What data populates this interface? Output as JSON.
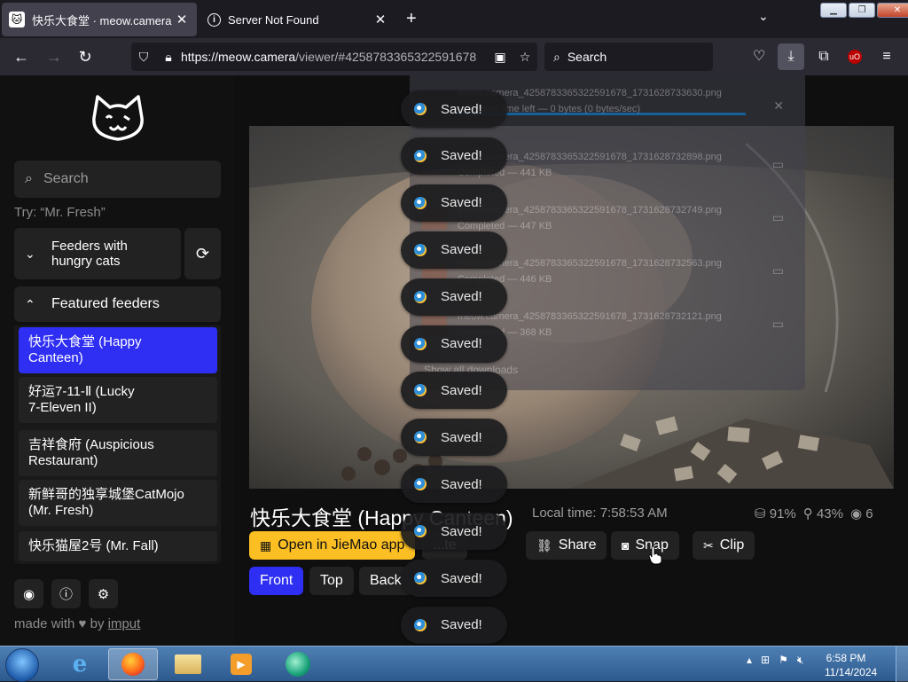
{
  "browser": {
    "tabs": [
      {
        "title": "快乐大食堂 · meow.camera",
        "active": true
      },
      {
        "title": "Server Not Found",
        "active": false
      }
    ],
    "url_host": "https://meow.camera",
    "url_path": "/viewer/#4258783365322591678",
    "search_placeholder": "Search",
    "ublock_label": "uO"
  },
  "downloads": {
    "items": [
      {
        "name": "meow.camera_4258783365322591678_1731628733630.png",
        "status": "Unknown time left — 0 bytes (0 bytes/sec)"
      },
      {
        "name": "meow.camera_4258783365322591678_1731628732898.png",
        "status": "Completed — 441 KB"
      },
      {
        "name": "meow.camera_4258783365322591678_1731628732749.png",
        "status": "Completed — 447 KB"
      },
      {
        "name": "meow.camera_4258783365322591678_1731628732563.png",
        "status": "Completed — 446 KB"
      },
      {
        "name": "meow.camera_4258783365322591678_1731628732121.png",
        "status": "Completed — 368 KB"
      }
    ],
    "show_all": "Show all downloads"
  },
  "sidebar": {
    "search_placeholder": "Search",
    "try_text": "Try: “Mr. Fresh”",
    "feeders_label_1": "Feeders with",
    "feeders_label_2": "hungry cats",
    "featured_label": "Featured feeders",
    "featured": [
      {
        "line1": "快乐大食堂 (Happy",
        "line2": "Canteen)",
        "selected": true
      },
      {
        "line1": "好运7-11-Ⅱ (Lucky",
        "line2": "7-Eleven II)",
        "selected": false
      },
      {
        "line1": "吉祥食府 (Auspicious",
        "line2": "Restaurant)",
        "selected": false
      },
      {
        "line1": "新鲜哥的独享城堡CatMojo",
        "line2": "(Mr. Fresh)",
        "selected": false
      },
      {
        "line1": "快乐猫屋2号 (Mr. Fall)",
        "line2": "",
        "selected": false
      }
    ],
    "made_with": "made with",
    "made_by": "by",
    "author": "imput"
  },
  "main": {
    "title": "快乐大食堂 (Happy Canteen)",
    "local_time": "Local time: 7:58:53 AM",
    "food_pct": "91%",
    "battery_pct": "43%",
    "viewers": "6",
    "buttons": {
      "open_app": "Open in JieMao app",
      "share": "Share",
      "snap": "Snap",
      "clip": "Clip",
      "hidden_partial": "...te"
    },
    "views": [
      "Front",
      "Top",
      "Back"
    ]
  },
  "toast_label": "Saved!",
  "toast_count": 12,
  "taskbar": {
    "time": "6:58 PM",
    "date": "11/14/2024"
  }
}
